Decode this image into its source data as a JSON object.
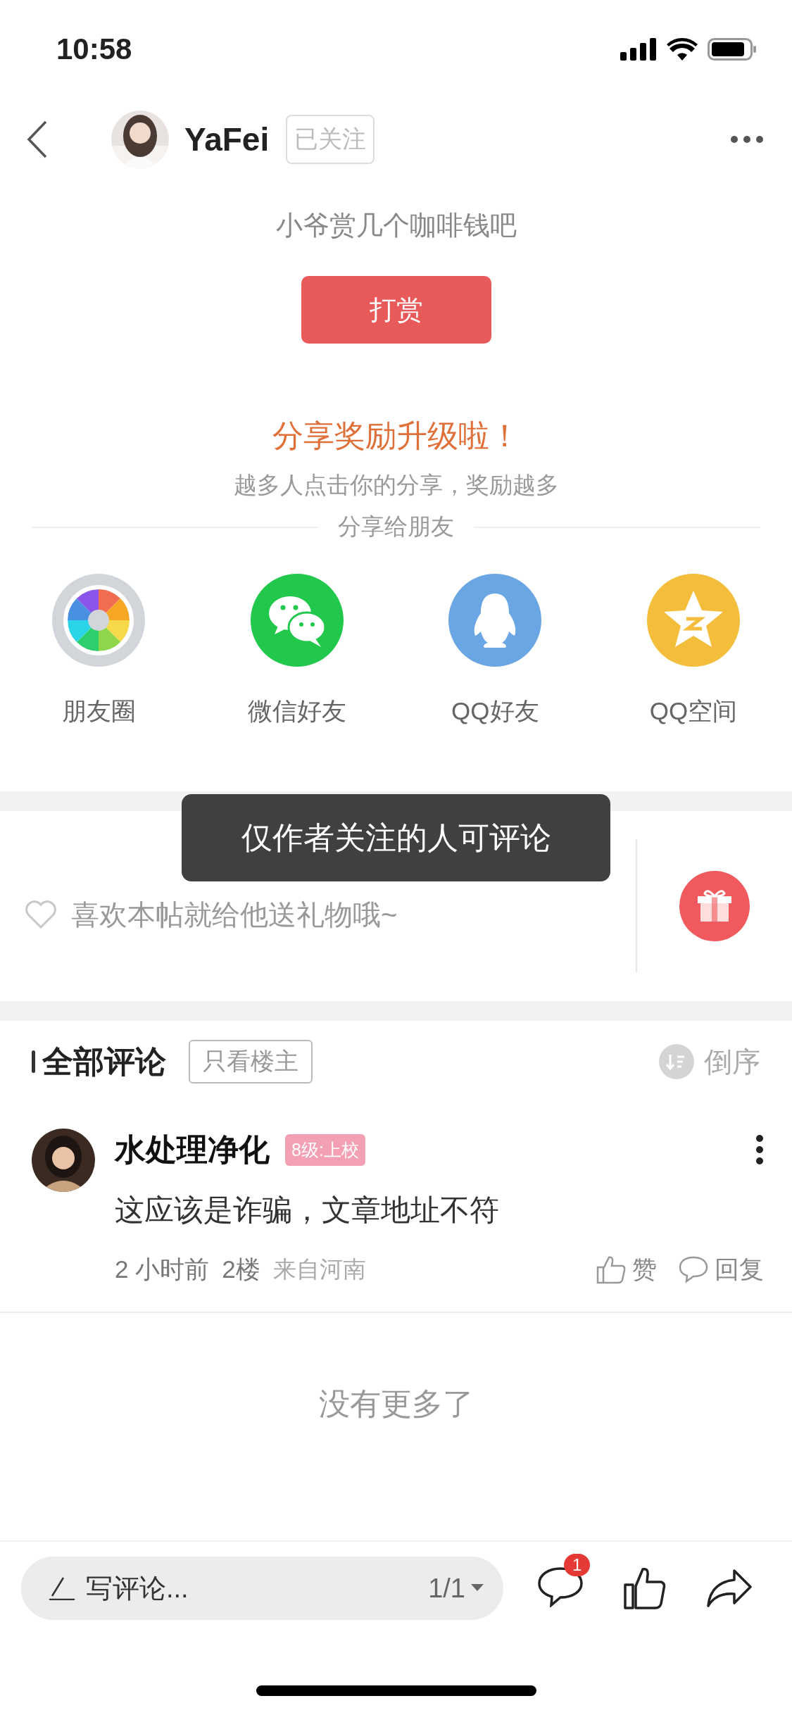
{
  "status_bar": {
    "time": "10:58"
  },
  "header": {
    "author": "YaFei",
    "follow_button": {
      "label": "已关注",
      "followed": true
    }
  },
  "reward": {
    "prompt": "小爷赏几个咖啡钱吧",
    "button": "打赏"
  },
  "share": {
    "title": "分享奖励升级啦！",
    "subtitle": "越多人点击你的分享，奖励越多",
    "heading": "分享给朋友",
    "targets": [
      {
        "kind": "moments",
        "label": "朋友圈"
      },
      {
        "kind": "wechat",
        "label": "微信好友"
      },
      {
        "kind": "qq",
        "label": "QQ好友"
      },
      {
        "kind": "qzone",
        "label": "QQ空间"
      }
    ]
  },
  "gift": {
    "text": "喜欢本帖就给他送礼物哦~"
  },
  "toast": "仅作者关注的人可评论",
  "comments": {
    "title": "全部评论",
    "owner_only": {
      "label": "只看楼主",
      "selected": false
    },
    "sort": "倒序",
    "items": [
      {
        "author": "水处理净化",
        "level_badge": "8级:上校",
        "text": "这应该是诈骗，文章地址不符",
        "time": "2 小时前",
        "floor": "2楼",
        "location": "来自河南",
        "like": "赞",
        "reply": "回复"
      }
    ],
    "end_text": "没有更多了"
  },
  "bottom_bar": {
    "placeholder": "写评论...",
    "page": "1/1",
    "comment_count": "1"
  }
}
